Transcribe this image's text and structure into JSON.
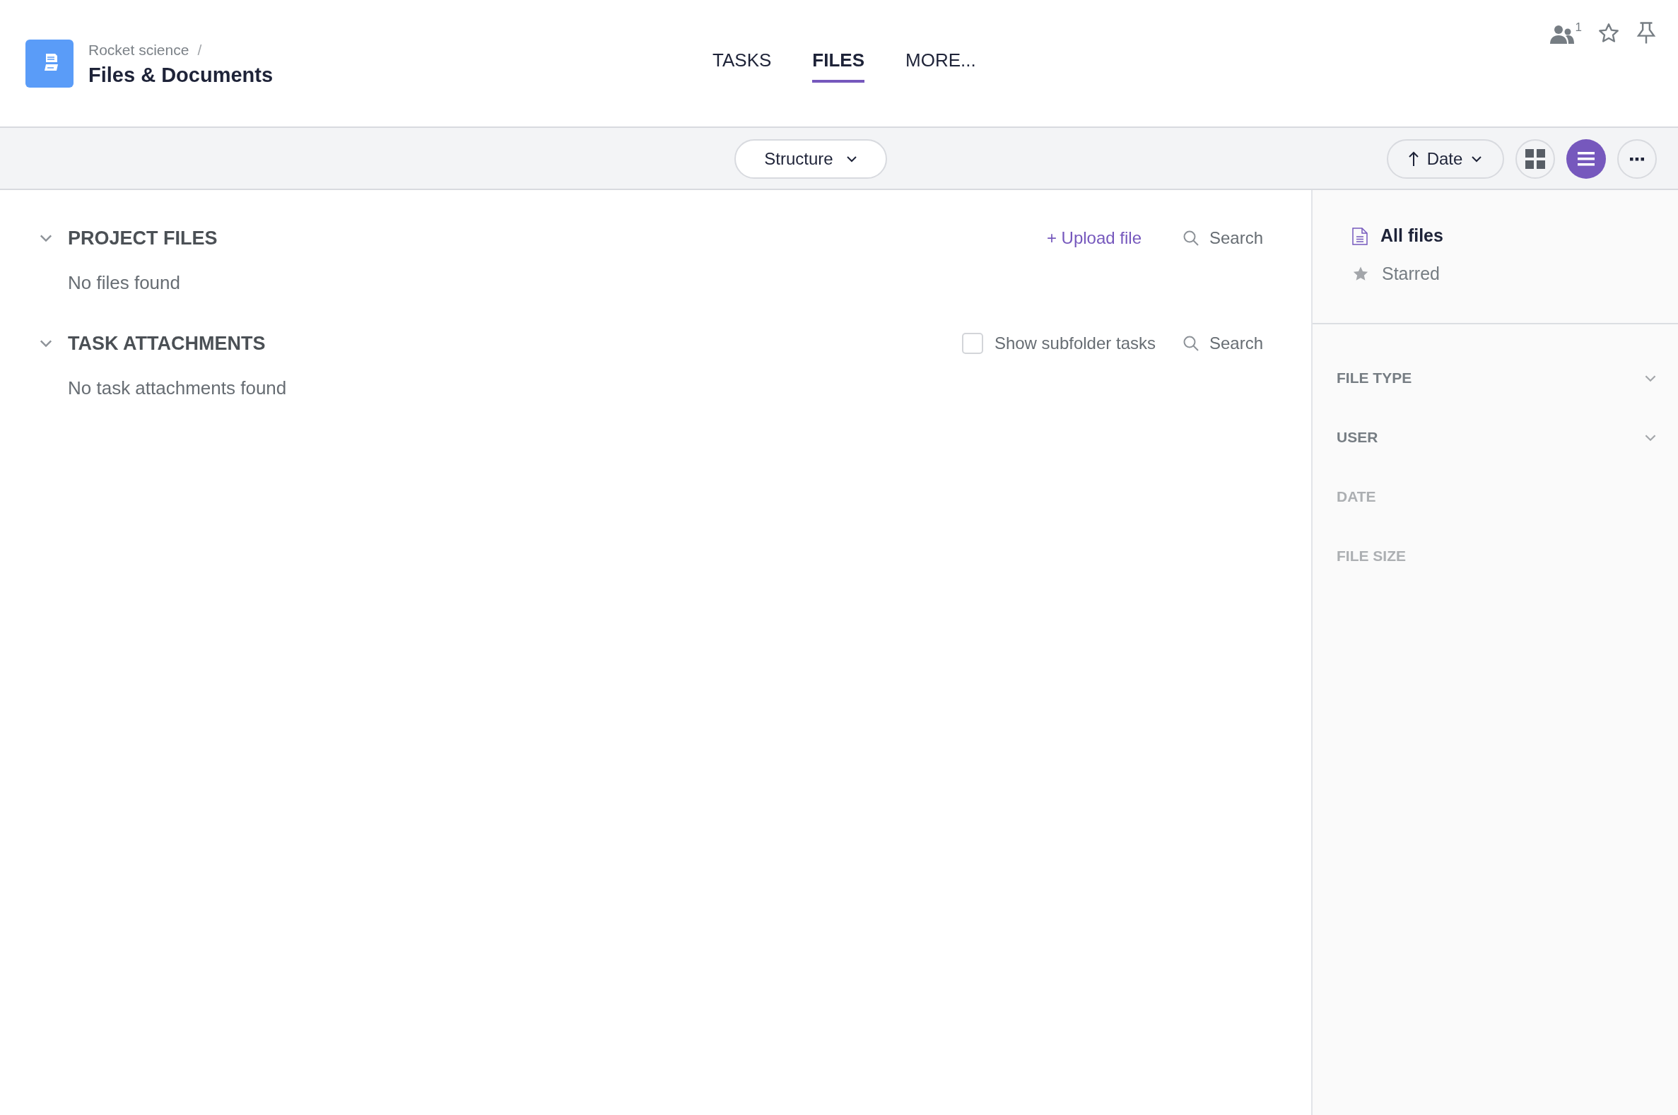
{
  "header": {
    "breadcrumb": "Rocket science",
    "separator": "/",
    "title": "Files & Documents",
    "members_count": "1"
  },
  "tabs": [
    {
      "label": "TASKS",
      "selected": false
    },
    {
      "label": "FILES",
      "selected": true
    },
    {
      "label": "MORE..."
    }
  ],
  "toolbar": {
    "structure": "Structure",
    "sort": "Date",
    "views": [
      {
        "kind": "grid",
        "selected": false
      },
      {
        "kind": "list",
        "selected": true
      }
    ]
  },
  "sections": [
    {
      "title": "PROJECT FILES",
      "expanded": true,
      "upload_link": "+ Upload file",
      "search_placeholder": "Search",
      "empty_text": "No files found"
    },
    {
      "title": "TASK ATTACHMENTS",
      "expanded": true,
      "checkbox": {
        "label": "Show subfolder tasks",
        "checked": false
      },
      "search_placeholder": "Search",
      "empty_text": "No task attachments found"
    }
  ],
  "sidebar": {
    "nav": [
      {
        "kind": "document",
        "label": "All files",
        "selected": true
      },
      {
        "kind": "star",
        "label": "Starred",
        "selected": false
      }
    ],
    "filters": [
      {
        "label": "FILE TYPE",
        "disabled": false
      },
      {
        "label": "USER",
        "disabled": false
      },
      {
        "label": "DATE",
        "disabled": true
      },
      {
        "label": "FILE SIZE",
        "disabled": true
      }
    ]
  }
}
